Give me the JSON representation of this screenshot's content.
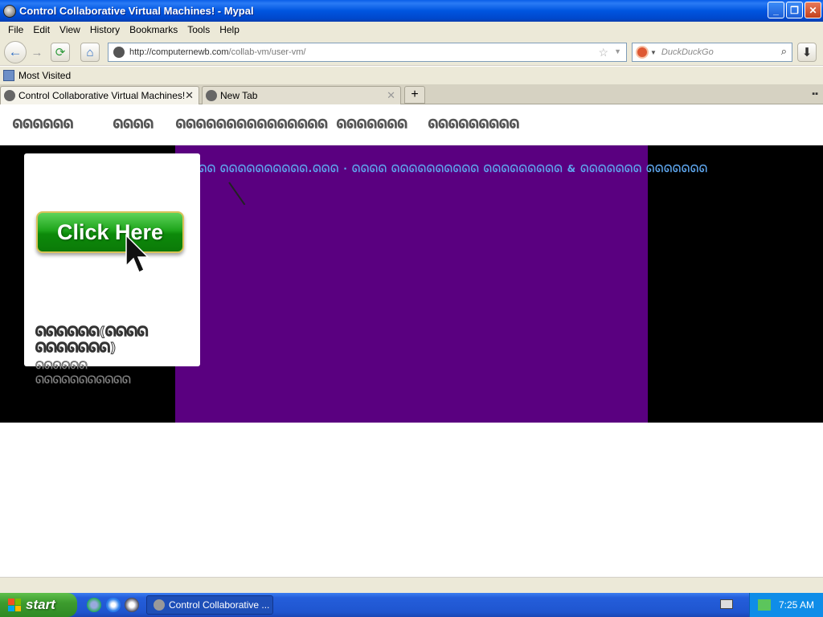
{
  "window": {
    "title": "Control Collaborative Virtual Machines! - Mypal",
    "minimize": "_",
    "maximize": "❐",
    "close": "✕"
  },
  "menu": [
    "File",
    "Edit",
    "View",
    "History",
    "Bookmarks",
    "Tools",
    "Help"
  ],
  "nav": {
    "back": "←",
    "forward": "→",
    "reload": "⟳",
    "home": "⌂",
    "url_host": "http://computernewb.com",
    "url_path": "/collab-vm/user-vm/",
    "bookmark_star": "☆",
    "url_dropdown": "▼",
    "search_placeholder": "DuckDuckGo",
    "search_dropdown": "▼",
    "search_icon": "⌕",
    "download": "⬇"
  },
  "bookmarks": {
    "most_visited": "Most Visited"
  },
  "tabs": [
    {
      "label": "Control Collaborative Virtual Machines!",
      "close": "✕"
    },
    {
      "label": "New Tab",
      "close": "✕"
    }
  ],
  "tabstrip": {
    "new_tab": "+",
    "list_all": "▪▪"
  },
  "site": {
    "nav_items": [
      "ᘏᘏᘏᘏᘏᘏ",
      "ᘏᘏᘏᘏ",
      "ᘏᘏᘏᘏᘏᘏᘏᘏᘏᘏᘏᘏᘏᘏᘏ",
      "ᘏᘏᘏᘏᘏᘏᘏ",
      "ᘏᘏᘏᘏᘏᘏᘏᘏᘏ"
    ],
    "headline": "ᘏᘏᘏᘏᘏᘏᘏᘏᘏ ᘏᘏ ᘏᘏᘏᘏᘏᘏᘏᘏᘏᘏ.ᘏᘏᘏ · ᘏᘏᘏᘏ ᘏᘏᘏᘏᘏᘏᘏᘏᘏᘏ ᘏᘏᘏᘏᘏᘏᘏᘏᘏ & ᘏᘏᘏᘏᘏᘏᘏ ᘏᘏᘏᘏᘏᘏᘏ",
    "click_here": "Click Here",
    "card_title": "ᘏᘏᘏᘏᘏᘏ(ᘏᘏᘏᘏ ᘏᘏᘏᘏᘏᘏᘏ)",
    "card_desc": "ᘏᘏᘏᘏᘏᘏ ᘏᘏᘏᘏᘏᘏᘏᘏᘏᘏᘏ"
  },
  "taskbar": {
    "start": "start",
    "task_label": "Control Collaborative ...",
    "clock": "7:25 AM"
  },
  "colors": {
    "hero_black": "#000000",
    "hero_purple": "#5a0080",
    "headline_blue": "#5fa8f0",
    "button_green": "#1fa51c"
  }
}
